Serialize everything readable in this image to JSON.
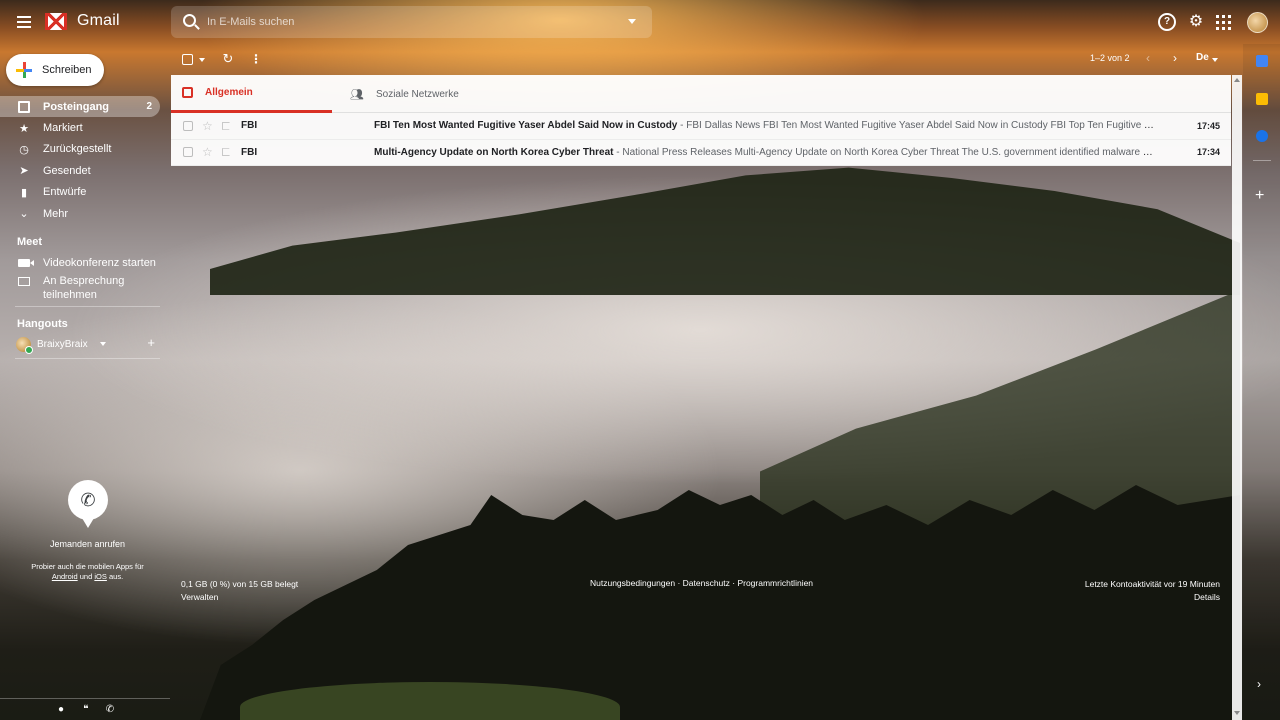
{
  "header": {
    "app_name": "Gmail",
    "search_placeholder": "In E-Mails suchen"
  },
  "sidebar": {
    "compose_label": "Schreiben",
    "items": [
      {
        "label": "Posteingang",
        "count": "2"
      },
      {
        "label": "Markiert"
      },
      {
        "label": "Zurückgestellt"
      },
      {
        "label": "Gesendet"
      },
      {
        "label": "Entwürfe"
      },
      {
        "label": "Mehr"
      }
    ],
    "meet": {
      "title": "Meet",
      "start_label": "Videokonferenz starten",
      "join_line1": "An Besprechung",
      "join_line2": "teilnehmen"
    },
    "hangouts": {
      "title": "Hangouts",
      "user": "BraixyBraix",
      "call_label": "Jemanden anrufen",
      "apps_note_prefix": "Probier auch die mobilen Apps für",
      "apps_note_android": "Android",
      "apps_note_and": "und",
      "apps_note_ios": "iOS",
      "apps_note_suffix": "aus."
    }
  },
  "toolbar": {
    "pagination": "1–2 von 2",
    "lang": "De"
  },
  "tabs": [
    {
      "label": "Allgemein",
      "active": true
    },
    {
      "label": "Soziale Netzwerke",
      "active": false
    }
  ],
  "emails": [
    {
      "sender": "FBI",
      "subject": "FBI Ten Most Wanted Fugitive Yaser Abdel Said Now in Custody",
      "snippet": " - FBI Dallas News FBI Ten Most Wanted Fugitive Yaser Abdel Said Now in Custody FBI Top Ten Fugitive Yaser Abdel S...",
      "time": "17:45"
    },
    {
      "sender": "FBI",
      "subject": "Multi-Agency Update on North Korea Cyber Threat",
      "snippet": " - National Press Releases Multi-Agency Update on North Korea Cyber Threat The U.S. government identified malware and indicator...",
      "time": "17:34"
    }
  ],
  "footer": {
    "storage": "0,1 GB (0 %) von 15 GB belegt",
    "manage": "Verwalten",
    "terms": "Nutzungsbedingungen",
    "sep": " · ",
    "privacy": "Datenschutz",
    "policies": "Programmrichtlinien",
    "activity": "Letzte Kontoaktivität vor 19 Minuten",
    "details": "Details"
  },
  "colors": {
    "accent_red": "#d93025",
    "calendar": "#4285f4",
    "keep": "#fbbc04",
    "tasks": "#1a73e8"
  },
  "icons": {
    "menu": "hamburger-icon",
    "search": "search-icon",
    "help": "help-icon",
    "settings": "gear-icon",
    "apps": "apps-grid-icon"
  }
}
